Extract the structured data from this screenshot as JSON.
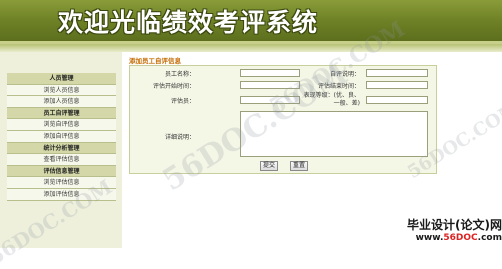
{
  "header": {
    "title": "欢迎光临绩效考评系统"
  },
  "sidebar": {
    "rows": [
      {
        "label": "人员管理",
        "kind": "header"
      },
      {
        "label": "浏览人员信息",
        "kind": "item"
      },
      {
        "label": "添加人员信息",
        "kind": "item"
      },
      {
        "label": "员工自评管理",
        "kind": "header"
      },
      {
        "label": "浏览自评信息",
        "kind": "item"
      },
      {
        "label": "添加自评信息",
        "kind": "item"
      },
      {
        "label": "统计分析管理",
        "kind": "header"
      },
      {
        "label": "查看评估信息",
        "kind": "item"
      },
      {
        "label": "评估信息管理",
        "kind": "header"
      },
      {
        "label": "浏览评估信息",
        "kind": "item"
      },
      {
        "label": "添加评估信息",
        "kind": "item"
      }
    ]
  },
  "form": {
    "section_title": "添加员工自评信息",
    "labels": {
      "employee_name": "员工名称：",
      "self_review": "自评说明：",
      "review_start": "评估开始时间：",
      "review_end": "评估结束时间：",
      "reviewer": "评估员：",
      "grade": "表现等级：(优、良、一般、差)",
      "details": "详细说明："
    },
    "values": {
      "employee_name": "",
      "self_review": "",
      "review_start": "",
      "review_end": "",
      "reviewer": "",
      "grade": "",
      "details": ""
    },
    "buttons": {
      "submit": "提交",
      "reset": "重置"
    }
  },
  "watermark": {
    "text": "56DOC.COM"
  },
  "footer": {
    "line1": "毕业设计(论文)网",
    "line2_prefix": "www.",
    "line2_accent": "56DOC",
    "line2_suffix": ".com"
  }
}
